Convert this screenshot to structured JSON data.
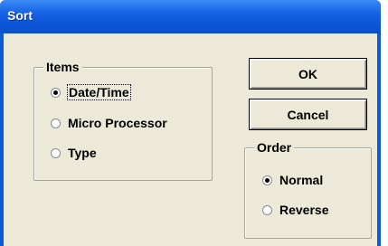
{
  "window": {
    "title": "Sort"
  },
  "items_group": {
    "label": "Items",
    "options": [
      {
        "label": "Date/Time",
        "selected": true,
        "focused": true
      },
      {
        "label": "Micro Processor",
        "selected": false
      },
      {
        "label": "Type",
        "selected": false
      }
    ]
  },
  "buttons": {
    "ok": "OK",
    "cancel": "Cancel"
  },
  "order_group": {
    "label": "Order",
    "options": [
      {
        "label": "Normal",
        "selected": true
      },
      {
        "label": "Reverse",
        "selected": false
      }
    ]
  }
}
